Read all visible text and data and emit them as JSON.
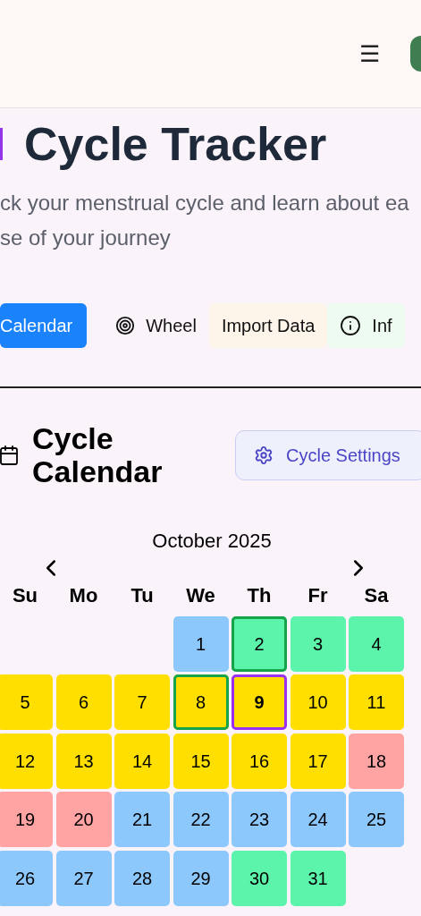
{
  "header": {
    "menu_icon": "☰"
  },
  "title": "Cycle Tracker",
  "subtitle_lines": [
    "ck your menstrual cycle and learn about ea",
    "se of your journey"
  ],
  "tabs": [
    {
      "label": "Calendar",
      "selected": true,
      "kind": "plain"
    },
    {
      "label": "Wheel",
      "selected": false,
      "kind": "wheel"
    },
    {
      "label": "Import Data",
      "selected": false,
      "kind": "import"
    },
    {
      "label": "Inf",
      "selected": false,
      "kind": "info"
    }
  ],
  "calendar": {
    "heading": "Cycle Calendar",
    "settings_button": "Cycle Settings",
    "month": "October 2025",
    "weekdays": [
      "Su",
      "Mo",
      "Tu",
      "We",
      "Th",
      "Fr",
      "Sa"
    ],
    "days": [
      {
        "kind": "blank"
      },
      {
        "kind": "blank"
      },
      {
        "kind": "blank"
      },
      {
        "kind": "day",
        "label": "1",
        "color": "#8dc8fd",
        "marked": false,
        "today": false
      },
      {
        "kind": "day",
        "label": "2",
        "color": "#5cf4ab",
        "marked": true,
        "today": false
      },
      {
        "kind": "day",
        "label": "3",
        "color": "#5cf4ab",
        "marked": false,
        "today": false
      },
      {
        "kind": "day",
        "label": "4",
        "color": "#5cf4ab",
        "marked": false,
        "today": false
      },
      {
        "kind": "day",
        "label": "5",
        "color": "#ffdf00",
        "marked": false,
        "today": false
      },
      {
        "kind": "day",
        "label": "6",
        "color": "#ffdf00",
        "marked": false,
        "today": false
      },
      {
        "kind": "day",
        "label": "7",
        "color": "#ffdf00",
        "marked": false,
        "today": false
      },
      {
        "kind": "day",
        "label": "8",
        "color": "#ffdf00",
        "marked": true,
        "today": false
      },
      {
        "kind": "day",
        "label": "9",
        "color": "#ffdf00",
        "marked": false,
        "today": true
      },
      {
        "kind": "day",
        "label": "10",
        "color": "#ffdf00",
        "marked": false,
        "today": false
      },
      {
        "kind": "day",
        "label": "11",
        "color": "#ffdf00",
        "marked": false,
        "today": false
      },
      {
        "kind": "day",
        "label": "12",
        "color": "#ffdf00",
        "marked": false,
        "today": false
      },
      {
        "kind": "day",
        "label": "13",
        "color": "#ffdf00",
        "marked": false,
        "today": false
      },
      {
        "kind": "day",
        "label": "14",
        "color": "#ffdf00",
        "marked": false,
        "today": false
      },
      {
        "kind": "day",
        "label": "15",
        "color": "#ffdf00",
        "marked": false,
        "today": false
      },
      {
        "kind": "day",
        "label": "16",
        "color": "#ffdf00",
        "marked": false,
        "today": false
      },
      {
        "kind": "day",
        "label": "17",
        "color": "#ffdf00",
        "marked": false,
        "today": false
      },
      {
        "kind": "day",
        "label": "18",
        "color": "#ffa3a3",
        "marked": false,
        "today": false
      },
      {
        "kind": "day",
        "label": "19",
        "color": "#ffa3a3",
        "marked": false,
        "today": false
      },
      {
        "kind": "day",
        "label": "20",
        "color": "#ffa3a3",
        "marked": false,
        "today": false
      },
      {
        "kind": "day",
        "label": "21",
        "color": "#8dc8fd",
        "marked": false,
        "today": false
      },
      {
        "kind": "day",
        "label": "22",
        "color": "#8dc8fd",
        "marked": false,
        "today": false
      },
      {
        "kind": "day",
        "label": "23",
        "color": "#8dc8fd",
        "marked": false,
        "today": false
      },
      {
        "kind": "day",
        "label": "24",
        "color": "#8dc8fd",
        "marked": false,
        "today": false
      },
      {
        "kind": "day",
        "label": "25",
        "color": "#8dc8fd",
        "marked": false,
        "today": false
      },
      {
        "kind": "day",
        "label": "26",
        "color": "#8dc8fd",
        "marked": false,
        "today": false
      },
      {
        "kind": "day",
        "label": "27",
        "color": "#8dc8fd",
        "marked": false,
        "today": false
      },
      {
        "kind": "day",
        "label": "28",
        "color": "#8dc8fd",
        "marked": false,
        "today": false
      },
      {
        "kind": "day",
        "label": "29",
        "color": "#8dc8fd",
        "marked": false,
        "today": false
      },
      {
        "kind": "day",
        "label": "30",
        "color": "#5cf4ab",
        "marked": false,
        "today": false
      },
      {
        "kind": "day",
        "label": "31",
        "color": "#5cf4ab",
        "marked": false,
        "today": false
      }
    ]
  }
}
